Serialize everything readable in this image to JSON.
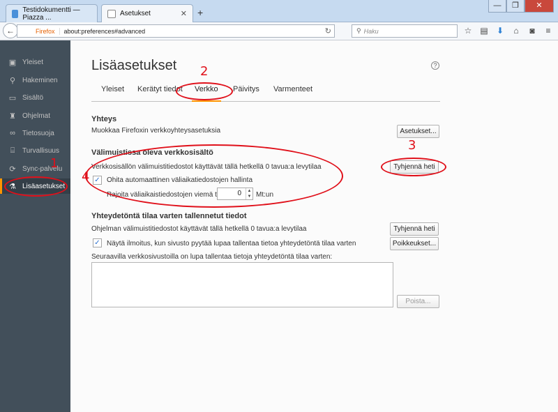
{
  "browser": {
    "tabs": [
      {
        "title": "Testidokumentti — Piazza ..."
      },
      {
        "title": "Asetukset"
      }
    ],
    "new_tab": "+",
    "window_buttons": {
      "minimize": "—",
      "maximize": "❐",
      "close": "✕"
    },
    "url": {
      "badge": "Firefox",
      "value": "about:preferences#advanced"
    },
    "search_placeholder": "Haku"
  },
  "sidebar": {
    "items": [
      {
        "label": "Yleiset",
        "icon": "general-icon"
      },
      {
        "label": "Hakeminen",
        "icon": "search-icon"
      },
      {
        "label": "Sisältö",
        "icon": "content-icon"
      },
      {
        "label": "Ohjelmat",
        "icon": "applications-icon"
      },
      {
        "label": "Tietosuoja",
        "icon": "privacy-icon"
      },
      {
        "label": "Turvallisuus",
        "icon": "security-icon"
      },
      {
        "label": "Sync-palvelu",
        "icon": "sync-icon"
      },
      {
        "label": "Lisäasetukset",
        "icon": "advanced-icon",
        "selected": true
      }
    ]
  },
  "main": {
    "title": "Lisäasetukset",
    "help": "?",
    "tabs": [
      {
        "label": "Yleiset"
      },
      {
        "label": "Kerätyt tiedot"
      },
      {
        "label": "Verkko",
        "active": true
      },
      {
        "label": "Päivitys"
      },
      {
        "label": "Varmenteet"
      }
    ],
    "connection": {
      "heading": "Yhteys",
      "description": "Muokkaa Firefoxin verkkoyhteysasetuksia",
      "button": "Asetukset..."
    },
    "cache": {
      "heading": "Välimuistissa oleva verkkosisältö",
      "description": "Verkkosisällön välimuistitiedostot käyttävät tällä hetkellä 0 tavua:a levytilaa",
      "clear_button": "Tyhjennä heti",
      "override_label": "Ohita automaattinen väliaikatiedostojen hallinta",
      "override_checked": true,
      "limit_label": "Rajoita väliaikaistiedostojen viemä tila",
      "limit_value": "0",
      "limit_unit": "Mt:un"
    },
    "offline": {
      "heading": "Yhteydetöntä tilaa varten tallennetut tiedot",
      "description": "Ohjelman välimuistitiedostot käyttävät tällä hetkellä 0 tavua:a levytilaa",
      "clear_button": "Tyhjennä heti",
      "notify_label": "Näytä ilmoitus, kun sivusto pyytää lupaa tallentaa tietoa yhteydetöntä tilaa varten",
      "notify_checked": true,
      "exceptions_button": "Poikkeukset...",
      "list_label": "Seuraavilla verkkosivustoilla on lupa tallentaa tietoja yhteydetöntä tilaa varten:",
      "remove_button": "Poista..."
    }
  },
  "annotations": {
    "n1": "1",
    "n2": "2",
    "n3": "3",
    "n4": "4",
    "color": "#e0101a"
  }
}
